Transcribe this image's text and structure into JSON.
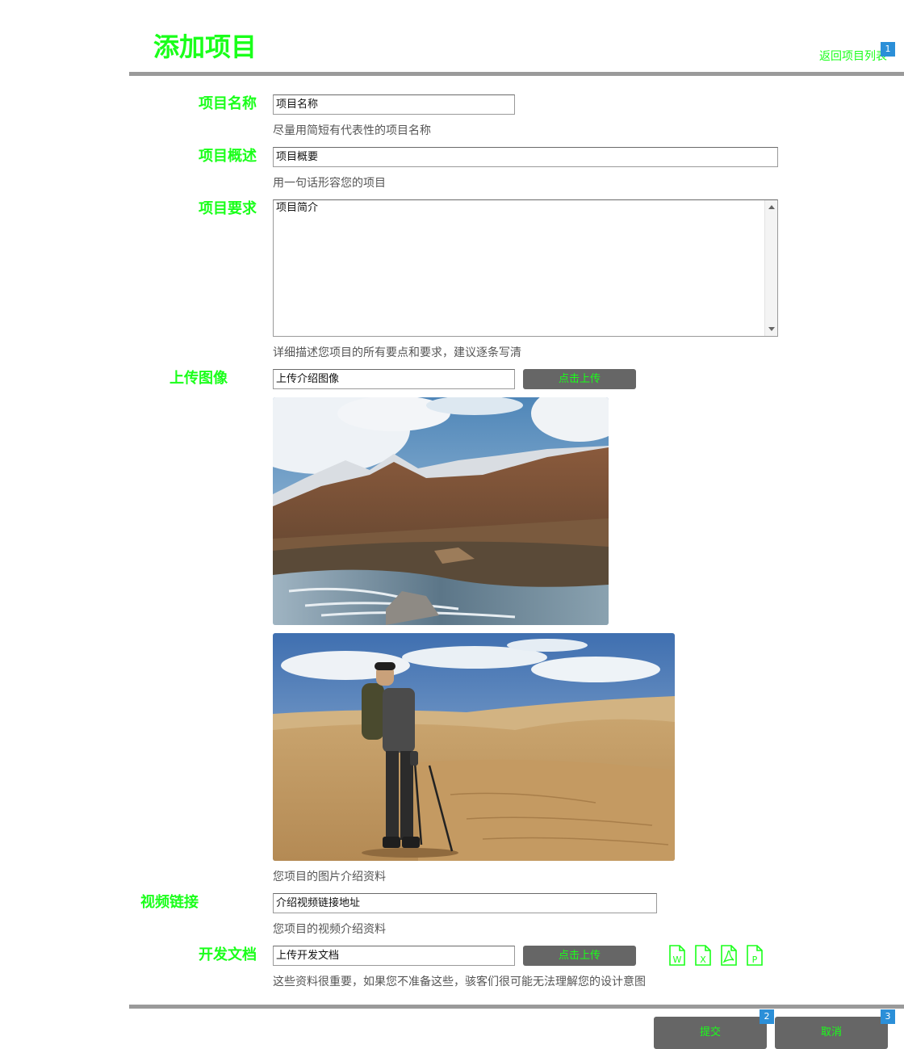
{
  "header": {
    "title": "添加项目",
    "back_link": "返回项目列表",
    "back_badge": "1"
  },
  "form": {
    "name": {
      "label": "项目名称",
      "value": "项目名称",
      "help": "尽量用简短有代表性的项目名称"
    },
    "summary": {
      "label": "项目概述",
      "value": "项目概要",
      "help": "用一句话形容您的项目"
    },
    "requirements": {
      "label": "项目要求",
      "value": "项目简介",
      "help": "详细描述您项目的所有要点和要求，建议逐条写清"
    },
    "image": {
      "label": "上传图像",
      "value": "上传介绍图像",
      "button": "点击上传",
      "help": "您项目的图片介绍资料",
      "photos": [
        "mountain-stream-photo",
        "desert-hiker-photo"
      ]
    },
    "video": {
      "label": "视频链接",
      "value": "介绍视频链接地址",
      "help": "您项目的视频介绍资料"
    },
    "docs": {
      "label": "开发文档",
      "value": "上传开发文档",
      "button": "点击上传",
      "help": "这些资料很重要，如果您不准备这些，骇客们很可能无法理解您的设计意图",
      "icons": [
        {
          "name": "word-file-icon",
          "letter": "W"
        },
        {
          "name": "excel-file-icon",
          "letter": "X"
        },
        {
          "name": "pdf-file-icon",
          "letter": ""
        },
        {
          "name": "powerpoint-file-icon",
          "letter": "P"
        }
      ]
    }
  },
  "footer": {
    "submit": "提交",
    "submit_badge": "2",
    "cancel": "取消",
    "cancel_badge": "3"
  },
  "colors": {
    "accent": "#1aff1a",
    "button_bg": "#666666",
    "badge": "#2b8fd8",
    "rule": "#9a9a9a"
  }
}
